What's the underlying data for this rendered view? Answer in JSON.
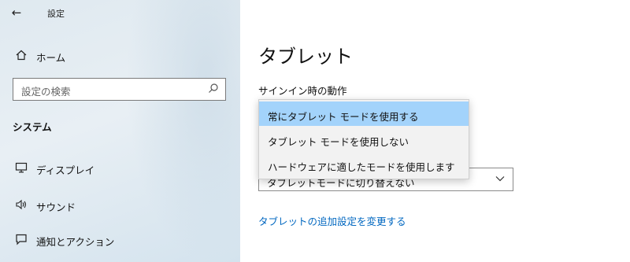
{
  "window": {
    "title": "設定"
  },
  "sidebar": {
    "home_label": "ホーム",
    "search": {
      "placeholder": "設定の検索"
    },
    "section_heading": "システム",
    "items": [
      {
        "label": "ディスプレイ",
        "icon": "monitor-icon"
      },
      {
        "label": "サウンド",
        "icon": "speaker-icon"
      },
      {
        "label": "通知とアクション",
        "icon": "notification-icon"
      }
    ]
  },
  "main": {
    "title": "タブレット",
    "signin_label": "サインイン時の動作",
    "dropdown_options": [
      "常にタブレット モードを使用する",
      "タブレット モードを使用しない",
      "ハードウェアに適したモードを使用します"
    ],
    "selected_index": 0,
    "second_combo_value": "タブレットモードに切り替えない",
    "link_text": "タブレットの追加設定を変更する"
  },
  "colors": {
    "accent_link": "#0067c0",
    "option_highlight": "#a3d3fb",
    "sidebar_bg": "#e4edf3"
  }
}
